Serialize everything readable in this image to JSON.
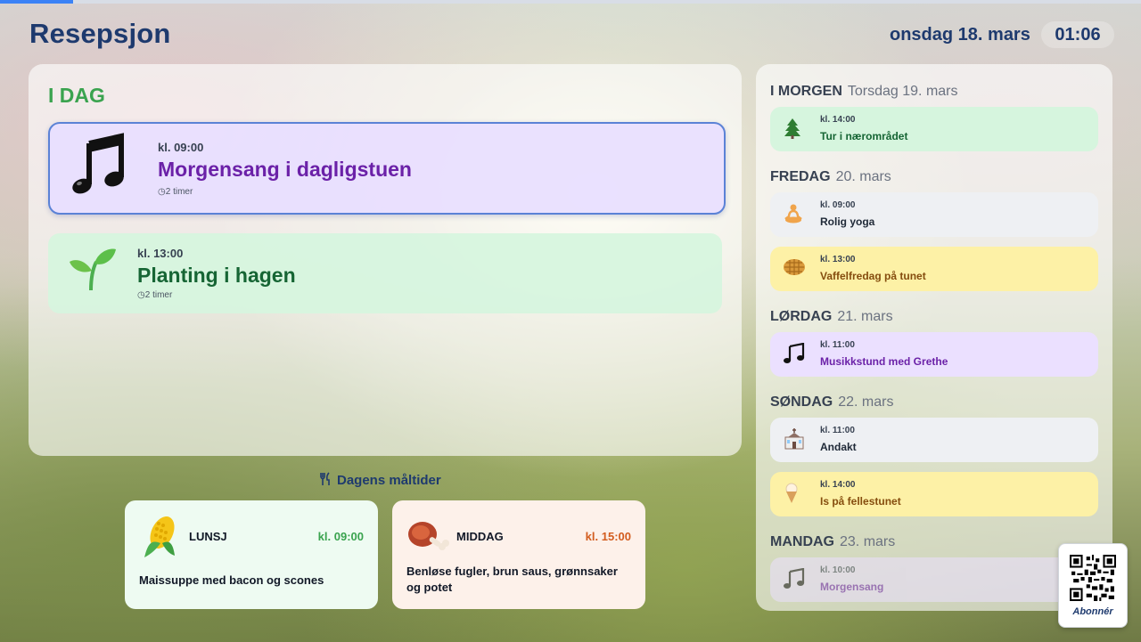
{
  "header": {
    "title": "Resepsjon",
    "date": "onsdag 18. mars",
    "time": "01:06",
    "progress_fraction": 0.064
  },
  "today": {
    "heading": "I DAG",
    "events": [
      {
        "time": "kl. 09:00",
        "name": "Morgensang i dagligstuen",
        "duration": "2 timer",
        "icon": "music-notes-icon",
        "color": "#6b21a8"
      },
      {
        "time": "kl. 13:00",
        "name": "Planting i hagen",
        "duration": "2 timer",
        "icon": "seedling-icon",
        "color": "#166534"
      }
    ]
  },
  "meals": {
    "heading": "Dagens måltider",
    "items": [
      {
        "name": "LUNSJ",
        "time": "kl. 09:00",
        "description": "Maissuppe med bacon og scones",
        "icon": "corn-icon"
      },
      {
        "name": "MIDDAG",
        "time": "kl. 15:00",
        "description": "Benløse fugler, brun saus, grønnsaker og potet",
        "icon": "meat-icon"
      }
    ]
  },
  "upcoming": {
    "days": [
      {
        "name": "I MORGEN",
        "date": "Torsdag 19. mars",
        "events": [
          {
            "time": "kl. 14:00",
            "name": "Tur i nærområdet",
            "icon": "tree-icon",
            "color": "green"
          }
        ]
      },
      {
        "name": "FREDAG",
        "date": "20. mars",
        "events": [
          {
            "time": "kl. 09:00",
            "name": "Rolig yoga",
            "icon": "yoga-icon",
            "color": "gray"
          },
          {
            "time": "kl. 13:00",
            "name": "Vaffelfredag på tunet",
            "icon": "waffle-icon",
            "color": "yellow"
          }
        ]
      },
      {
        "name": "LØRDAG",
        "date": "21. mars",
        "events": [
          {
            "time": "kl. 11:00",
            "name": "Musikkstund med Grethe",
            "icon": "music-notes-icon",
            "color": "purple"
          }
        ]
      },
      {
        "name": "SØNDAG",
        "date": "22. mars",
        "events": [
          {
            "time": "kl. 11:00",
            "name": "Andakt",
            "icon": "church-icon",
            "color": "gray"
          },
          {
            "time": "kl. 14:00",
            "name": "Is på fellestunet",
            "icon": "ice-cream-icon",
            "color": "yellow"
          }
        ]
      },
      {
        "name": "MANDAG",
        "date": "23. mars",
        "events": [
          {
            "time": "kl. 10:00",
            "name": "Morgensang",
            "icon": "music-notes-icon",
            "color": "purple"
          }
        ]
      }
    ]
  },
  "subscribe": {
    "label": "Abonnér"
  },
  "colors": {
    "accent": "#1e3a6e",
    "today_heading": "#3aa34f",
    "lunch_time": "#3aa34f",
    "dinner_time": "#d35d1f"
  }
}
